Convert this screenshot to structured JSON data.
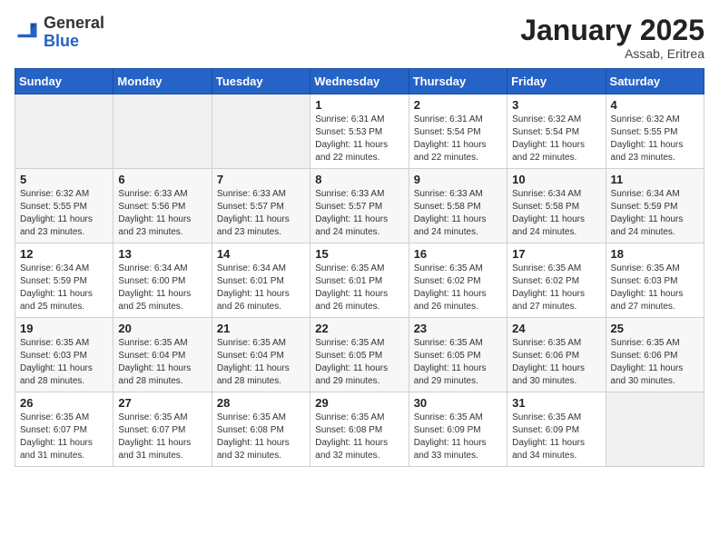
{
  "header": {
    "logo_general": "General",
    "logo_blue": "Blue",
    "month_title": "January 2025",
    "subtitle": "Assab, Eritrea"
  },
  "weekdays": [
    "Sunday",
    "Monday",
    "Tuesday",
    "Wednesday",
    "Thursday",
    "Friday",
    "Saturday"
  ],
  "weeks": [
    [
      {
        "day": "",
        "info": ""
      },
      {
        "day": "",
        "info": ""
      },
      {
        "day": "",
        "info": ""
      },
      {
        "day": "1",
        "info": "Sunrise: 6:31 AM\nSunset: 5:53 PM\nDaylight: 11 hours\nand 22 minutes."
      },
      {
        "day": "2",
        "info": "Sunrise: 6:31 AM\nSunset: 5:54 PM\nDaylight: 11 hours\nand 22 minutes."
      },
      {
        "day": "3",
        "info": "Sunrise: 6:32 AM\nSunset: 5:54 PM\nDaylight: 11 hours\nand 22 minutes."
      },
      {
        "day": "4",
        "info": "Sunrise: 6:32 AM\nSunset: 5:55 PM\nDaylight: 11 hours\nand 23 minutes."
      }
    ],
    [
      {
        "day": "5",
        "info": "Sunrise: 6:32 AM\nSunset: 5:55 PM\nDaylight: 11 hours\nand 23 minutes."
      },
      {
        "day": "6",
        "info": "Sunrise: 6:33 AM\nSunset: 5:56 PM\nDaylight: 11 hours\nand 23 minutes."
      },
      {
        "day": "7",
        "info": "Sunrise: 6:33 AM\nSunset: 5:57 PM\nDaylight: 11 hours\nand 23 minutes."
      },
      {
        "day": "8",
        "info": "Sunrise: 6:33 AM\nSunset: 5:57 PM\nDaylight: 11 hours\nand 24 minutes."
      },
      {
        "day": "9",
        "info": "Sunrise: 6:33 AM\nSunset: 5:58 PM\nDaylight: 11 hours\nand 24 minutes."
      },
      {
        "day": "10",
        "info": "Sunrise: 6:34 AM\nSunset: 5:58 PM\nDaylight: 11 hours\nand 24 minutes."
      },
      {
        "day": "11",
        "info": "Sunrise: 6:34 AM\nSunset: 5:59 PM\nDaylight: 11 hours\nand 24 minutes."
      }
    ],
    [
      {
        "day": "12",
        "info": "Sunrise: 6:34 AM\nSunset: 5:59 PM\nDaylight: 11 hours\nand 25 minutes."
      },
      {
        "day": "13",
        "info": "Sunrise: 6:34 AM\nSunset: 6:00 PM\nDaylight: 11 hours\nand 25 minutes."
      },
      {
        "day": "14",
        "info": "Sunrise: 6:34 AM\nSunset: 6:01 PM\nDaylight: 11 hours\nand 26 minutes."
      },
      {
        "day": "15",
        "info": "Sunrise: 6:35 AM\nSunset: 6:01 PM\nDaylight: 11 hours\nand 26 minutes."
      },
      {
        "day": "16",
        "info": "Sunrise: 6:35 AM\nSunset: 6:02 PM\nDaylight: 11 hours\nand 26 minutes."
      },
      {
        "day": "17",
        "info": "Sunrise: 6:35 AM\nSunset: 6:02 PM\nDaylight: 11 hours\nand 27 minutes."
      },
      {
        "day": "18",
        "info": "Sunrise: 6:35 AM\nSunset: 6:03 PM\nDaylight: 11 hours\nand 27 minutes."
      }
    ],
    [
      {
        "day": "19",
        "info": "Sunrise: 6:35 AM\nSunset: 6:03 PM\nDaylight: 11 hours\nand 28 minutes."
      },
      {
        "day": "20",
        "info": "Sunrise: 6:35 AM\nSunset: 6:04 PM\nDaylight: 11 hours\nand 28 minutes."
      },
      {
        "day": "21",
        "info": "Sunrise: 6:35 AM\nSunset: 6:04 PM\nDaylight: 11 hours\nand 28 minutes."
      },
      {
        "day": "22",
        "info": "Sunrise: 6:35 AM\nSunset: 6:05 PM\nDaylight: 11 hours\nand 29 minutes."
      },
      {
        "day": "23",
        "info": "Sunrise: 6:35 AM\nSunset: 6:05 PM\nDaylight: 11 hours\nand 29 minutes."
      },
      {
        "day": "24",
        "info": "Sunrise: 6:35 AM\nSunset: 6:06 PM\nDaylight: 11 hours\nand 30 minutes."
      },
      {
        "day": "25",
        "info": "Sunrise: 6:35 AM\nSunset: 6:06 PM\nDaylight: 11 hours\nand 30 minutes."
      }
    ],
    [
      {
        "day": "26",
        "info": "Sunrise: 6:35 AM\nSunset: 6:07 PM\nDaylight: 11 hours\nand 31 minutes."
      },
      {
        "day": "27",
        "info": "Sunrise: 6:35 AM\nSunset: 6:07 PM\nDaylight: 11 hours\nand 31 minutes."
      },
      {
        "day": "28",
        "info": "Sunrise: 6:35 AM\nSunset: 6:08 PM\nDaylight: 11 hours\nand 32 minutes."
      },
      {
        "day": "29",
        "info": "Sunrise: 6:35 AM\nSunset: 6:08 PM\nDaylight: 11 hours\nand 32 minutes."
      },
      {
        "day": "30",
        "info": "Sunrise: 6:35 AM\nSunset: 6:09 PM\nDaylight: 11 hours\nand 33 minutes."
      },
      {
        "day": "31",
        "info": "Sunrise: 6:35 AM\nSunset: 6:09 PM\nDaylight: 11 hours\nand 34 minutes."
      },
      {
        "day": "",
        "info": ""
      }
    ]
  ]
}
